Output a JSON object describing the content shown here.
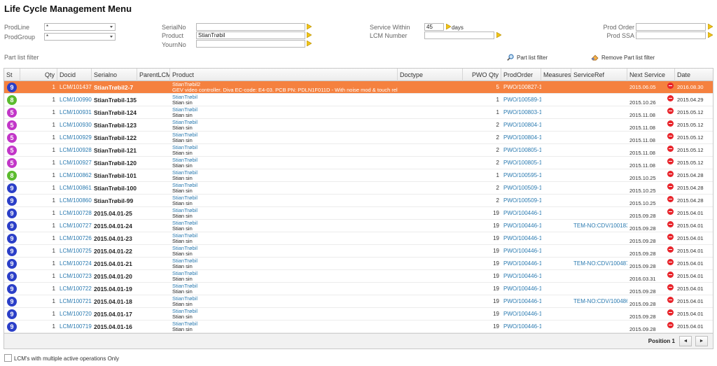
{
  "page": {
    "title": "Life Cycle Management Menu"
  },
  "filters": {
    "prodline": {
      "label": "ProdLine",
      "value": "*"
    },
    "prodgroup": {
      "label": "ProdGroup",
      "value": "*"
    },
    "serialno": {
      "label": "SerialNo",
      "value": ""
    },
    "product": {
      "label": "Product",
      "value": "StianTrøbil"
    },
    "yournno": {
      "label": "YournNo",
      "value": ""
    },
    "service_within": {
      "label": "Service Within",
      "value": "45",
      "unit": "days"
    },
    "lcm_number": {
      "label": "LCM Number",
      "value": ""
    },
    "prod_order": {
      "label": "Prod Order",
      "value": ""
    },
    "prod_ssa": {
      "label": "Prod SSA",
      "value": ""
    }
  },
  "part_filter": {
    "title": "Part list filter",
    "filter_button": "Part list filter",
    "remove_button": "Remove Part list filter"
  },
  "grid": {
    "columns": {
      "st": "St",
      "qty": "Qty",
      "docid": "Docid",
      "serialno": "Serialno",
      "parentlcm": "ParentLCM",
      "product": "Product",
      "doctype": "Doctype",
      "pwo_qty": "PWO Qty",
      "prodorder": "ProdOrder",
      "measures": "Measures",
      "serviceref": "ServiceRef",
      "next_service": "Next Service",
      "date": "Date"
    },
    "rows": [
      {
        "st": "9",
        "qty": "1",
        "docid": "LCM/101437",
        "serial": "StianTrøbil2-7",
        "pname": "StianTrøbil2",
        "pdesc": "GEV video controller. Diva EC-code: E4-03. PCB PN: PDLN1F011D - With noise mod & touch rel.(...)",
        "pwo": "5",
        "order": "PWO/100827-1",
        "sref": "",
        "next": "2015.06.05",
        "date": "2016.08.30"
      },
      {
        "st": "8",
        "qty": "1",
        "docid": "LCM/100990",
        "serial": "StianTrøbil-135",
        "pname": "StianTrøbil",
        "pdesc": "Stian sin",
        "pwo": "1",
        "order": "PWO/100589-1",
        "sref": "",
        "next": "2015.10.26",
        "date": "2015.04.29"
      },
      {
        "st": "5",
        "qty": "1",
        "docid": "LCM/100931",
        "serial": "StianTrøbil-124",
        "pname": "StianTrøbil",
        "pdesc": "Stian sin",
        "pwo": "1",
        "order": "PWO/100803-1",
        "sref": "",
        "next": "2015.11.08",
        "date": "2015.05.12"
      },
      {
        "st": "5",
        "qty": "1",
        "docid": "LCM/100930",
        "serial": "StianTrøbil-123",
        "pname": "StianTrøbil",
        "pdesc": "Stian sin",
        "pwo": "2",
        "order": "PWO/100804-1",
        "sref": "",
        "next": "2015.11.08",
        "date": "2015.05.12"
      },
      {
        "st": "5",
        "qty": "1",
        "docid": "LCM/100929",
        "serial": "StianTrøbil-122",
        "pname": "StianTrøbil",
        "pdesc": "Stian sin",
        "pwo": "2",
        "order": "PWO/100804-1",
        "sref": "",
        "next": "2015.11.08",
        "date": "2015.05.12"
      },
      {
        "st": "5",
        "qty": "1",
        "docid": "LCM/100928",
        "serial": "StianTrøbil-121",
        "pname": "StianTrøbil",
        "pdesc": "Stian sin",
        "pwo": "2",
        "order": "PWO/100805-1",
        "sref": "",
        "next": "2015.11.08",
        "date": "2015.05.12"
      },
      {
        "st": "5",
        "qty": "1",
        "docid": "LCM/100927",
        "serial": "StianTrøbil-120",
        "pname": "StianTrøbil",
        "pdesc": "Stian sin",
        "pwo": "2",
        "order": "PWO/100805-1",
        "sref": "",
        "next": "2015.11.08",
        "date": "2015.05.12"
      },
      {
        "st": "8",
        "qty": "1",
        "docid": "LCM/100862",
        "serial": "StianTrøbil-101",
        "pname": "StianTrøbil",
        "pdesc": "Stian sin",
        "pwo": "1",
        "order": "PWO/100595-1",
        "sref": "",
        "next": "2015.10.25",
        "date": "2015.04.28"
      },
      {
        "st": "9",
        "qty": "1",
        "docid": "LCM/100861",
        "serial": "StianTrøbil-100",
        "pname": "StianTrøbil",
        "pdesc": "Stian sin",
        "pwo": "2",
        "order": "PWO/100509-1",
        "sref": "",
        "next": "2015.10.25",
        "date": "2015.04.28"
      },
      {
        "st": "9",
        "qty": "1",
        "docid": "LCM/100860",
        "serial": "StianTrøbil-99",
        "pname": "StianTrøbil",
        "pdesc": "Stian sin",
        "pwo": "2",
        "order": "PWO/100509-1",
        "sref": "",
        "next": "2015.10.25",
        "date": "2015.04.28"
      },
      {
        "st": "9",
        "qty": "1",
        "docid": "LCM/100728",
        "serial": "2015.04.01-25",
        "pname": "StianTrøbil",
        "pdesc": "Stian sin",
        "pwo": "19",
        "order": "PWO/100446-1",
        "sref": "",
        "next": "2015.09.28",
        "date": "2015.04.01"
      },
      {
        "st": "9",
        "qty": "1",
        "docid": "LCM/100727",
        "serial": "2015.04.01-24",
        "pname": "StianTrøbil",
        "pdesc": "Stian sin",
        "pwo": "19",
        "order": "PWO/100446-1",
        "sref": "TEM-NO:CDV/100183",
        "next": "2015.09.28",
        "date": "2015.04.01"
      },
      {
        "st": "9",
        "qty": "1",
        "docid": "LCM/100726",
        "serial": "2015.04.01-23",
        "pname": "StianTrøbil",
        "pdesc": "Stian sin",
        "pwo": "19",
        "order": "PWO/100446-1",
        "sref": "",
        "next": "2015.09.28",
        "date": "2015.04.01"
      },
      {
        "st": "9",
        "qty": "1",
        "docid": "LCM/100725",
        "serial": "2015.04.01-22",
        "pname": "StianTrøbil",
        "pdesc": "Stian sin",
        "pwo": "19",
        "order": "PWO/100446-1",
        "sref": "",
        "next": "2015.09.28",
        "date": "2015.04.01"
      },
      {
        "st": "9",
        "qty": "1",
        "docid": "LCM/100724",
        "serial": "2015.04.01-21",
        "pname": "StianTrøbil",
        "pdesc": "Stian sin",
        "pwo": "19",
        "order": "PWO/100446-1",
        "sref": "TEM-NO:CDV/100487",
        "next": "2015.09.28",
        "date": "2015.04.01"
      },
      {
        "st": "9",
        "qty": "1",
        "docid": "LCM/100723",
        "serial": "2015.04.01-20",
        "pname": "StianTrøbil",
        "pdesc": "Stian sin",
        "pwo": "19",
        "order": "PWO/100446-1",
        "sref": "",
        "next": "2016.03.31",
        "date": "2015.04.01"
      },
      {
        "st": "9",
        "qty": "1",
        "docid": "LCM/100722",
        "serial": "2015.04.01-19",
        "pname": "StianTrøbil",
        "pdesc": "Stian sin",
        "pwo": "19",
        "order": "PWO/100446-1",
        "sref": "",
        "next": "2015.09.28",
        "date": "2015.04.01"
      },
      {
        "st": "9",
        "qty": "1",
        "docid": "LCM/100721",
        "serial": "2015.04.01-18",
        "pname": "StianTrøbil",
        "pdesc": "Stian sin",
        "pwo": "19",
        "order": "PWO/100446-1",
        "sref": "TEM-NO:CDV/100486",
        "next": "2015.09.28",
        "date": "2015.04.01"
      },
      {
        "st": "9",
        "qty": "1",
        "docid": "LCM/100720",
        "serial": "2015.04.01-17",
        "pname": "StianTrøbil",
        "pdesc": "Stian sin",
        "pwo": "19",
        "order": "PWO/100446-1",
        "sref": "",
        "next": "2015.09.28",
        "date": "2015.04.01"
      },
      {
        "st": "9",
        "qty": "1",
        "docid": "LCM/100719",
        "serial": "2015.04.01-16",
        "pname": "StianTrøbil",
        "pdesc": "Stian sin",
        "pwo": "19",
        "order": "PWO/100446-1",
        "sref": "",
        "next": "2015.09.28",
        "date": "2015.04.01"
      }
    ],
    "status_colors": {
      "5": "#c236c8",
      "8": "#5bbb2e",
      "9": "#2b3fc8"
    },
    "selected_row": 0,
    "selected_color": "#f5813f",
    "link_color": "#2a7ab0",
    "overdue_icon": "stop-icon"
  },
  "pager": {
    "position_label": "Position 1",
    "prev": "◄",
    "next": "►"
  },
  "options": {
    "multi_ops_label": "LCM's with multiple active operations Only",
    "multi_ops_checked": false
  }
}
